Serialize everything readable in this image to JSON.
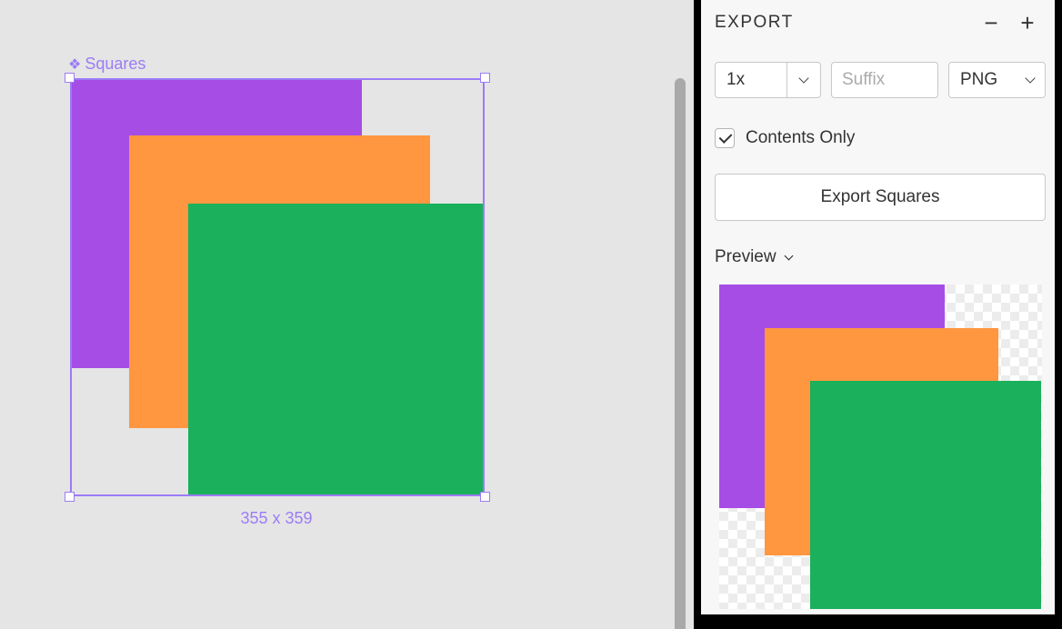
{
  "canvas": {
    "artboard_label": "Squares",
    "artboard_symbol": "❖",
    "dimensions": "355 x 359",
    "shapes": [
      {
        "name": "purple-square",
        "color": "#a64de6"
      },
      {
        "name": "orange-square",
        "color": "#ff9640"
      },
      {
        "name": "green-square",
        "color": "#1bb05b"
      }
    ],
    "selection_color": "#9b7cf6"
  },
  "export_panel": {
    "title": "EXPORT",
    "minus_icon": "−",
    "plus_icon": "+",
    "scale_value": "1x",
    "suffix_placeholder": "Suffix",
    "format_value": "PNG",
    "contents_only_label": "Contents Only",
    "contents_only_checked": true,
    "export_button_label": "Export Squares",
    "preview_label": "Preview"
  }
}
